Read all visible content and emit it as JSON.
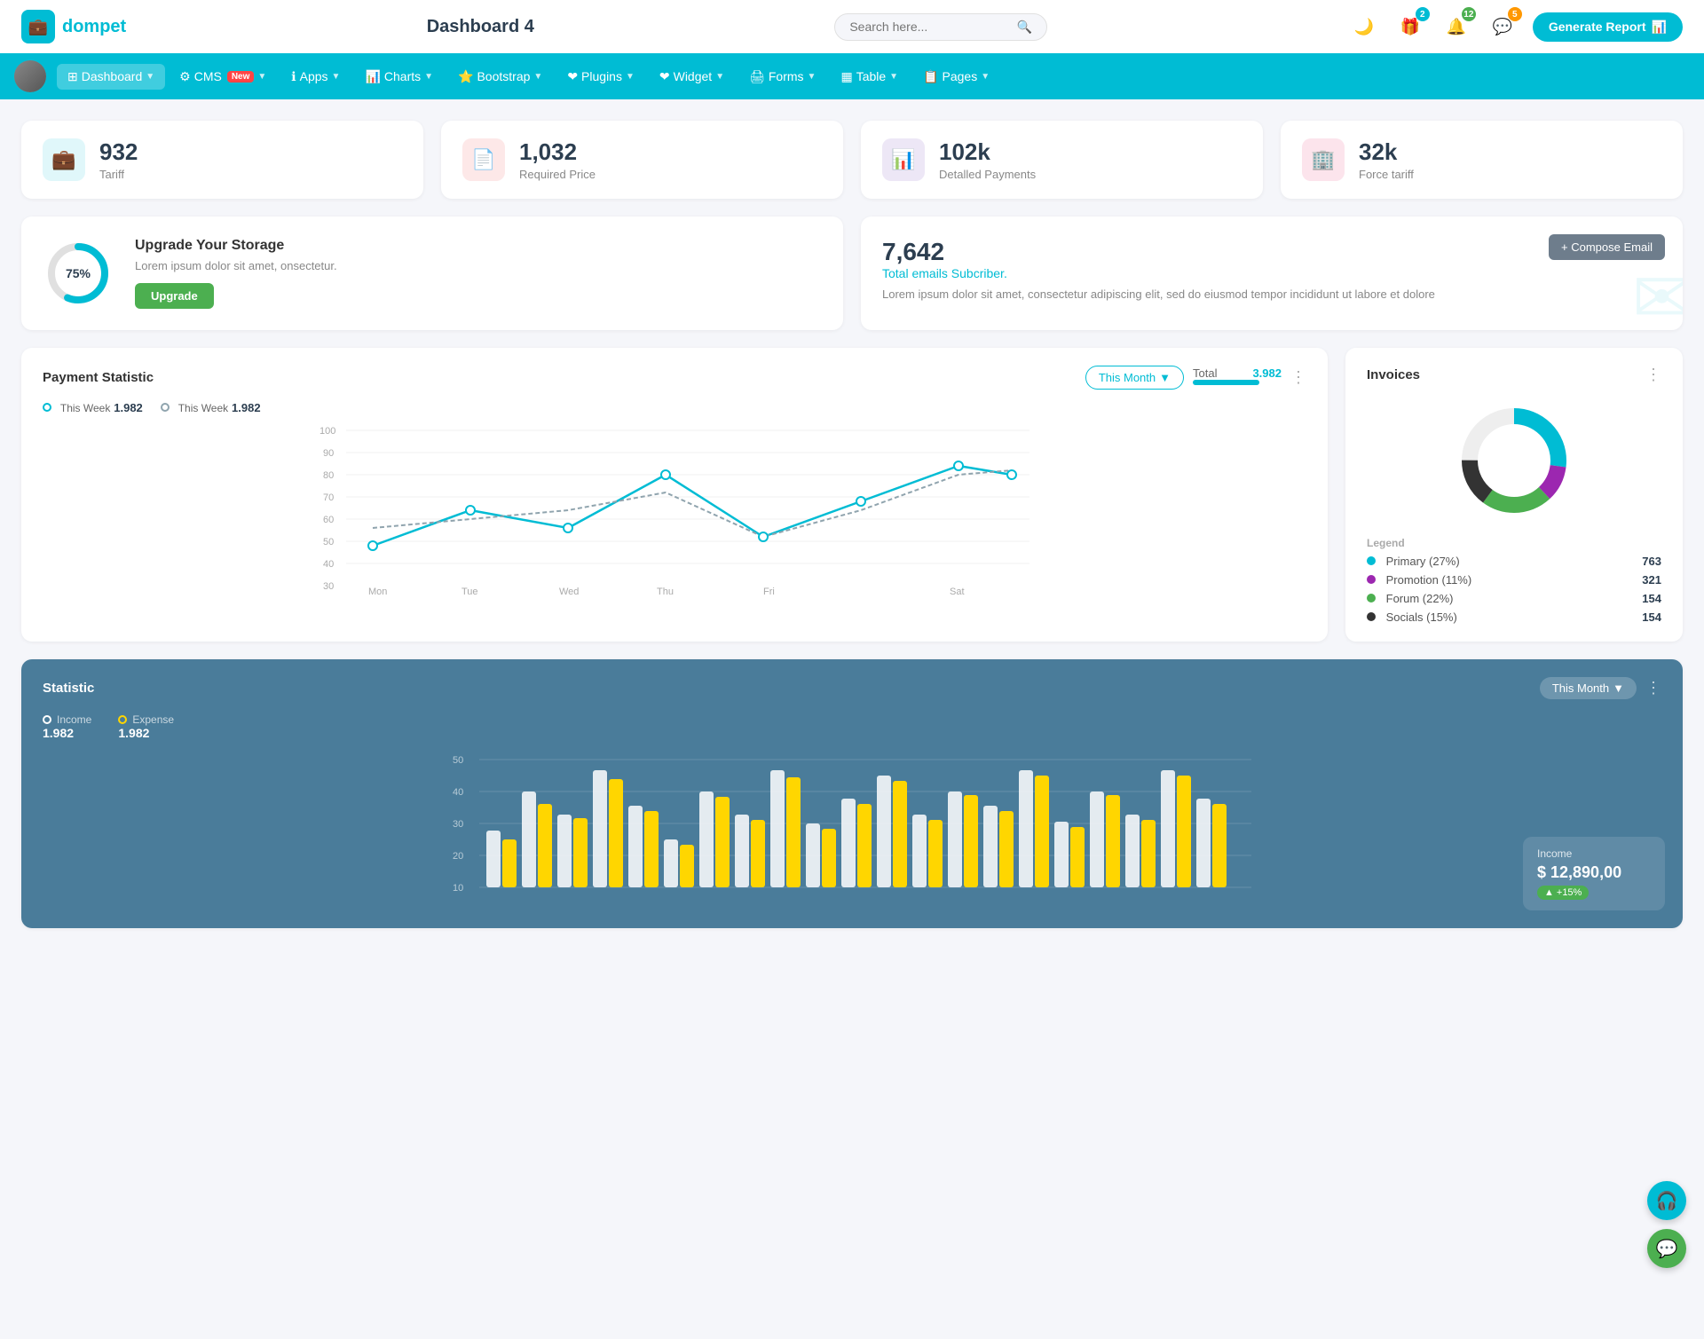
{
  "app": {
    "logo_icon": "💼",
    "logo_text": "dompet",
    "title": "Dashboard 4",
    "search_placeholder": "Search here...",
    "generate_report_label": "Generate Report"
  },
  "topbar_actions": {
    "dark_mode_icon": "🌙",
    "gift_icon": "🎁",
    "gift_badge": "2",
    "bell_icon": "🔔",
    "bell_badge": "12",
    "message_icon": "💬",
    "message_badge": "5"
  },
  "navbar": {
    "items": [
      {
        "label": "Dashboard",
        "has_arrow": true,
        "active": true,
        "icon": "⊞"
      },
      {
        "label": "CMS",
        "has_arrow": true,
        "active": false,
        "icon": "⚙",
        "has_new": true
      },
      {
        "label": "Apps",
        "has_arrow": true,
        "active": false,
        "icon": "ℹ"
      },
      {
        "label": "Charts",
        "has_arrow": true,
        "active": false,
        "icon": "📊"
      },
      {
        "label": "Bootstrap",
        "has_arrow": true,
        "active": false,
        "icon": "⭐"
      },
      {
        "label": "Plugins",
        "has_arrow": true,
        "active": false,
        "icon": "❤"
      },
      {
        "label": "Widget",
        "has_arrow": true,
        "active": false,
        "icon": "❤"
      },
      {
        "label": "Forms",
        "has_arrow": true,
        "active": false,
        "icon": "🖨"
      },
      {
        "label": "Table",
        "has_arrow": true,
        "active": false,
        "icon": "▦"
      },
      {
        "label": "Pages",
        "has_arrow": true,
        "active": false,
        "icon": "📋"
      }
    ]
  },
  "stat_cards": [
    {
      "icon": "💼",
      "icon_class": "stat-icon-teal",
      "value": "932",
      "label": "Tariff"
    },
    {
      "icon": "📄",
      "icon_class": "stat-icon-red",
      "value": "1,032",
      "label": "Required Price"
    },
    {
      "icon": "📊",
      "icon_class": "stat-icon-purple",
      "value": "102k",
      "label": "Detalled Payments"
    },
    {
      "icon": "🏢",
      "icon_class": "stat-icon-pink",
      "value": "32k",
      "label": "Force tariff"
    }
  ],
  "storage": {
    "title": "Upgrade Your Storage",
    "description": "Lorem ipsum dolor sit amet, onsectetur.",
    "percent": 75,
    "percent_label": "75%",
    "upgrade_label": "Upgrade"
  },
  "email": {
    "count": "7,642",
    "subtitle": "Total emails Subcriber.",
    "description": "Lorem ipsum dolor sit amet, consectetur adipiscing elit, sed do eiusmod tempor incididunt ut labore et dolore",
    "compose_label": "+ Compose Email"
  },
  "payment": {
    "title": "Payment Statistic",
    "filter_label": "This Month",
    "legend": [
      {
        "label": "This Week",
        "value": "1.982",
        "color": "teal"
      },
      {
        "label": "This Week",
        "value": "1.982",
        "color": "gray"
      }
    ],
    "total_label": "Total",
    "total_value": "3.982",
    "x_labels": [
      "Mon",
      "Tue",
      "Wed",
      "Thu",
      "Fri",
      "Sat"
    ],
    "y_labels": [
      "100",
      "90",
      "80",
      "70",
      "60",
      "50",
      "40",
      "30"
    ],
    "line1_points": "40,160 120,100 200,120 280,60 360,120 440,100 520,100 600,50 680,100 760,60",
    "line2_points": "40,120 120,110 200,100 280,80 360,120 440,100 520,120 600,60 680,120 760,60"
  },
  "invoices": {
    "title": "Invoices",
    "legend": [
      {
        "label": "Primary (27%)",
        "color": "#00bcd4",
        "value": "763"
      },
      {
        "label": "Promotion (11%)",
        "color": "#9c27b0",
        "value": "321"
      },
      {
        "label": "Forum (22%)",
        "color": "#4caf50",
        "value": "154"
      },
      {
        "label": "Socials (15%)",
        "color": "#333",
        "value": "154"
      }
    ]
  },
  "statistic": {
    "title": "Statistic",
    "filter_label": "This Month",
    "income_label": "Income",
    "income_value": "1.982",
    "expense_label": "Expense",
    "expense_value": "1.982",
    "income_panel_label": "Income",
    "income_panel_value": "$ 12,890,00",
    "income_badge": "+15%",
    "y_labels": [
      "50",
      "40",
      "30",
      "20",
      "10"
    ],
    "bar_data": [
      18,
      35,
      22,
      42,
      28,
      16,
      38,
      24,
      44,
      18,
      30,
      40,
      22,
      36,
      28,
      44,
      20,
      36,
      22,
      40
    ]
  }
}
